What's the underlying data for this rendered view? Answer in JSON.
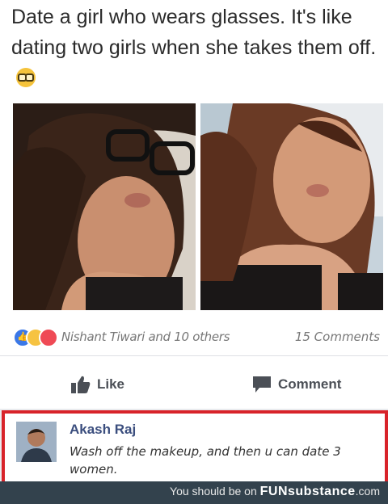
{
  "post": {
    "text": "Date a girl who wears glasses. It's like dating two girls when she takes them off.",
    "emoji": "nerd-face-with-glasses"
  },
  "reactions": {
    "names": "Nishant Tiwari and 10 others",
    "comments": "15 Comments",
    "icons": [
      "like",
      "haha",
      "love"
    ]
  },
  "actions": {
    "like_label": "Like",
    "comment_label": "Comment"
  },
  "comment": {
    "author": "Akash Raj",
    "text": "Wash off the makeup, and then u can date 3 women."
  },
  "footer": {
    "prefix": "You should be on",
    "brand": "FUNsubstance",
    "suffix": ".com"
  },
  "colors": {
    "highlight_border": "#d8232a",
    "author_name": "#3b4e7e",
    "footer_bg": "#33424d"
  }
}
